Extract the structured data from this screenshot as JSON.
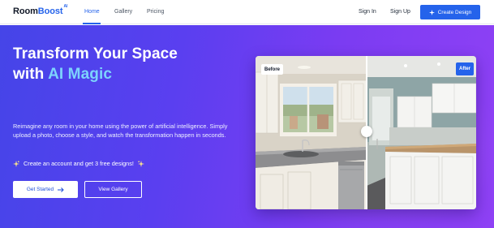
{
  "brand": {
    "name_part1": "Room",
    "name_part2": "Boost",
    "badge": "AI"
  },
  "nav": {
    "links": [
      {
        "label": "Home",
        "active": true
      },
      {
        "label": "Gallery",
        "active": false
      },
      {
        "label": "Pricing",
        "active": false
      }
    ],
    "sign_in": "Sign In",
    "sign_up": "Sign Up",
    "cta": "Create Design"
  },
  "hero": {
    "headline_line1": "Transform Your Space",
    "headline_line2_prefix": "with",
    "headline_line2_accent": "AI Magic",
    "description": "Reimagine any room in your home using the power of artificial intelligence. Simply upload a photo, choose a style, and watch the transformation happen in seconds.",
    "promo": "Create an account and get 3 free designs!",
    "primary_button": "Get Started",
    "secondary_button": "View Gallery"
  },
  "comparison": {
    "before_label": "Before",
    "after_label": "After",
    "slider_position_fraction": 0.5
  },
  "colors": {
    "primary": "#2563eb",
    "hero_gradient_start": "#4545e8",
    "hero_gradient_end": "#8f41f5",
    "headline_accent": "#7dd3fc"
  },
  "icons": {
    "cta": "sparkle-icon",
    "promo": "sparkle-icon",
    "primary_button": "arrow-right-icon"
  }
}
